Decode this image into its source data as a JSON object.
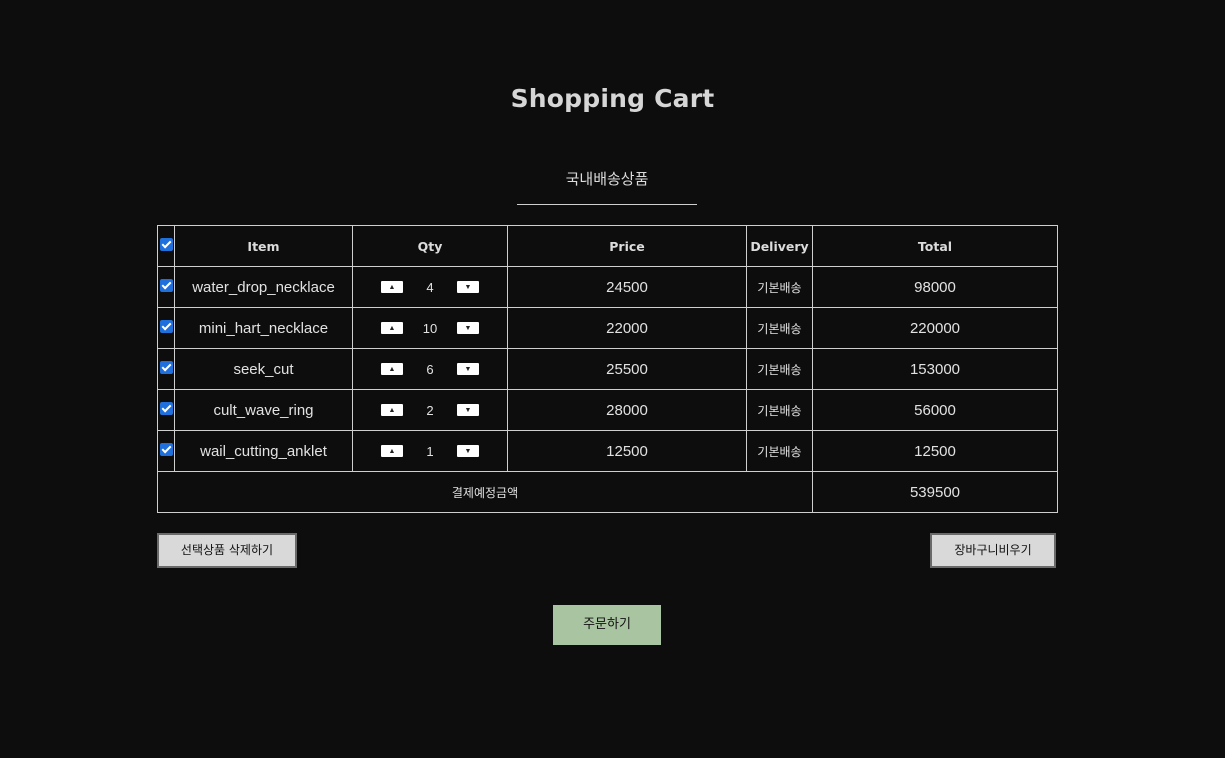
{
  "page": {
    "title": "Shopping Cart",
    "subtitle": "국내배송상품"
  },
  "table": {
    "headers": {
      "item": "Item",
      "qty": "Qty",
      "price": "Price",
      "delivery": "Delivery",
      "total": "Total"
    },
    "rows": [
      {
        "item": "water_drop_necklace",
        "qty": "4",
        "price": "24500",
        "delivery": "기본배송",
        "total": "98000",
        "checked": true
      },
      {
        "item": "mini_hart_necklace",
        "qty": "10",
        "price": "22000",
        "delivery": "기본배송",
        "total": "220000",
        "checked": true
      },
      {
        "item": "seek_cut",
        "qty": "6",
        "price": "25500",
        "delivery": "기본배송",
        "total": "153000",
        "checked": true
      },
      {
        "item": "cult_wave_ring",
        "qty": "2",
        "price": "28000",
        "delivery": "기본배송",
        "total": "56000",
        "checked": true
      },
      {
        "item": "wail_cutting_anklet",
        "qty": "1",
        "price": "12500",
        "delivery": "기본배송",
        "total": "12500",
        "checked": true
      }
    ],
    "summary": {
      "label": "결제예정금액",
      "amount": "539500"
    }
  },
  "buttons": {
    "delete_selected": "선택상품 삭제하기",
    "clear_cart": "장바구니비우기",
    "order": "주문하기"
  },
  "icons": {
    "qty_up": "triangle-up-icon",
    "qty_down": "triangle-down-icon",
    "checkbox": "checkmark-icon"
  },
  "colors": {
    "background": "#0d0d0d",
    "checkbox": "#1f6fdc",
    "order_button": "#a9c4a0",
    "secondary_button": "#d9d9d9"
  }
}
